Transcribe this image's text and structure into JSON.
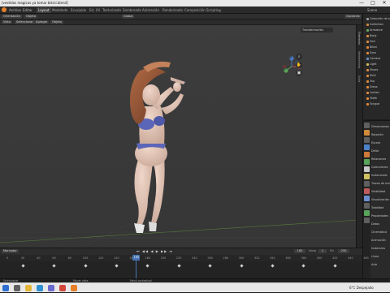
{
  "window": {
    "title": "[vestidos magicos ya tomar bikini.blend]",
    "controls": [
      "—",
      "□",
      "✕"
    ]
  },
  "menubar": {
    "menus": [
      "Archivo",
      "Editar",
      "Procesar",
      "Ventana",
      "Ayuda"
    ],
    "workspaces": [
      "Layout",
      "Modelado",
      "Esculpido",
      "Ed. UV",
      "Texturizado",
      "Sombreado",
      "Animación",
      "Renderizado",
      "Composición",
      "Scripting"
    ],
    "active_workspace": "Layout",
    "scene": "Scene"
  },
  "toolheader": {
    "mode": "Objeto",
    "orientation": "Orientación",
    "view_menu": "Vista",
    "select_menu": "Seleccionar",
    "add_menu": "Agregar",
    "object_menu": "Objeto",
    "transform_pivot": "Global",
    "options": "Opciones"
  },
  "viewport": {
    "npanel_header": "Transformación",
    "gizmo": {
      "x": "X",
      "y": "Y",
      "z": "Z"
    },
    "npanel_tabs": [
      "Elemento",
      "Herramienta",
      "Vista"
    ]
  },
  "outliner": {
    "rows": [
      {
        "label": "Colección de escena",
        "color": "#9a9a9a"
      },
      {
        "label": "Collection",
        "color": "#d08a3a"
      },
      {
        "label": "Armature",
        "color": "#6aa85a"
      },
      {
        "label": "Body",
        "color": "#e08a3a"
      },
      {
        "label": "Hair",
        "color": "#e08a3a"
      },
      {
        "label": "Bikini",
        "color": "#e08a3a"
      },
      {
        "label": "Eyes",
        "color": "#e08a3a"
      },
      {
        "label": "Camera",
        "color": "#6a8fd0"
      },
      {
        "label": "Light",
        "color": "#d0c060"
      },
      {
        "label": "Shoes",
        "color": "#e08a3a"
      },
      {
        "label": "Skirt",
        "color": "#e08a3a"
      },
      {
        "label": "Top",
        "color": "#e08a3a"
      },
      {
        "label": "Dress",
        "color": "#e08a3a"
      },
      {
        "label": "Lashes",
        "color": "#e08a3a"
      },
      {
        "label": "Teeth",
        "color": "#e08a3a"
      },
      {
        "label": "Tongue",
        "color": "#e08a3a"
      }
    ]
  },
  "properties": {
    "rows": [
      "Dimensiones",
      "Rotación",
      "Escala",
      "Delta",
      "Relaciones",
      "Colecciones",
      "Instanciado",
      "Trazos de movimiento",
      "Visibilidad",
      "Visualización en viewport",
      "Totalidad",
      "Propiedades",
      "Datos",
      "Cinemática",
      "Animación",
      "Instancias",
      "Línea",
      "Arte"
    ],
    "icon_colors": [
      "#5f5f5f",
      "#d08a3a",
      "#5f5f5f",
      "#4b82c9",
      "#d07a3a",
      "#5aa35a",
      "#c8c8c8",
      "#d0c060",
      "#5f5f5f",
      "#c05a5a",
      "#6a8fd0",
      "#5f5f5f",
      "#5aa35a",
      "#5f5f5f"
    ]
  },
  "timeline": {
    "menus": [
      "Reproducción",
      "Clave",
      "Vista",
      "Marcador"
    ],
    "start_label": "Inicio",
    "start": "1",
    "end_label": "Fin",
    "end": "250",
    "current_frame": "165",
    "ticks": [
      0,
      20,
      40,
      60,
      80,
      100,
      120,
      140,
      160,
      180,
      200,
      220,
      240,
      260,
      280,
      300,
      320,
      340,
      360,
      380,
      400,
      420,
      440,
      460
    ],
    "keyframes": [
      20,
      60,
      100,
      140,
      180,
      220,
      260,
      300,
      340,
      380,
      420
    ],
    "transport": [
      "⏮",
      "◀◀",
      "◀",
      "▶",
      "▶▶",
      "⏭"
    ]
  },
  "status": {
    "left": "Seleccionar",
    "mid": "Mover vista",
    "right": "Menú contextual"
  },
  "taskbar": {
    "weather": "6°C Despejado",
    "icons": [
      {
        "name": "windows-start-icon",
        "color": "#2f6fd0"
      },
      {
        "name": "search-icon",
        "color": "#5f5f5f"
      },
      {
        "name": "file-explorer-icon",
        "color": "#e3b53a"
      },
      {
        "name": "edge-browser-icon",
        "color": "#2f8fd0"
      },
      {
        "name": "store-icon",
        "color": "#6a6ad0"
      },
      {
        "name": "chrome-icon",
        "color": "#d0473a"
      },
      {
        "name": "blender-icon",
        "color": "#e6802a"
      }
    ]
  }
}
